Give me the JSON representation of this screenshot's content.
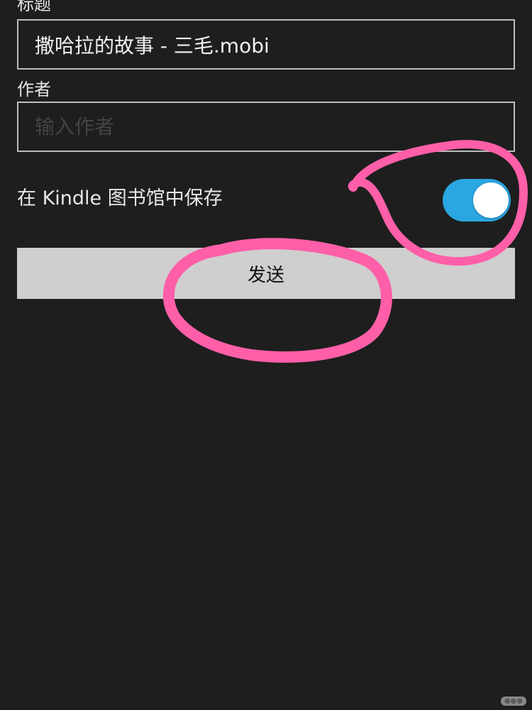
{
  "form": {
    "title_label": "标题",
    "title_value": "撒哈拉的故事 - 三毛.mobi",
    "author_label": "作者",
    "author_placeholder": "输入作者",
    "author_value": "",
    "save_to_library_label": "在 Kindle 图书馆中保存",
    "save_to_library_on": true,
    "send_label": "发送"
  },
  "colors": {
    "background": "#1e1e1e",
    "toggle_on": "#2aa6e0",
    "button_bg": "#cfcfcf",
    "annotation": "#ff5fa8"
  },
  "annotations": {
    "shapes": [
      "toggle-circle-marker",
      "send-button-circle-marker"
    ]
  }
}
